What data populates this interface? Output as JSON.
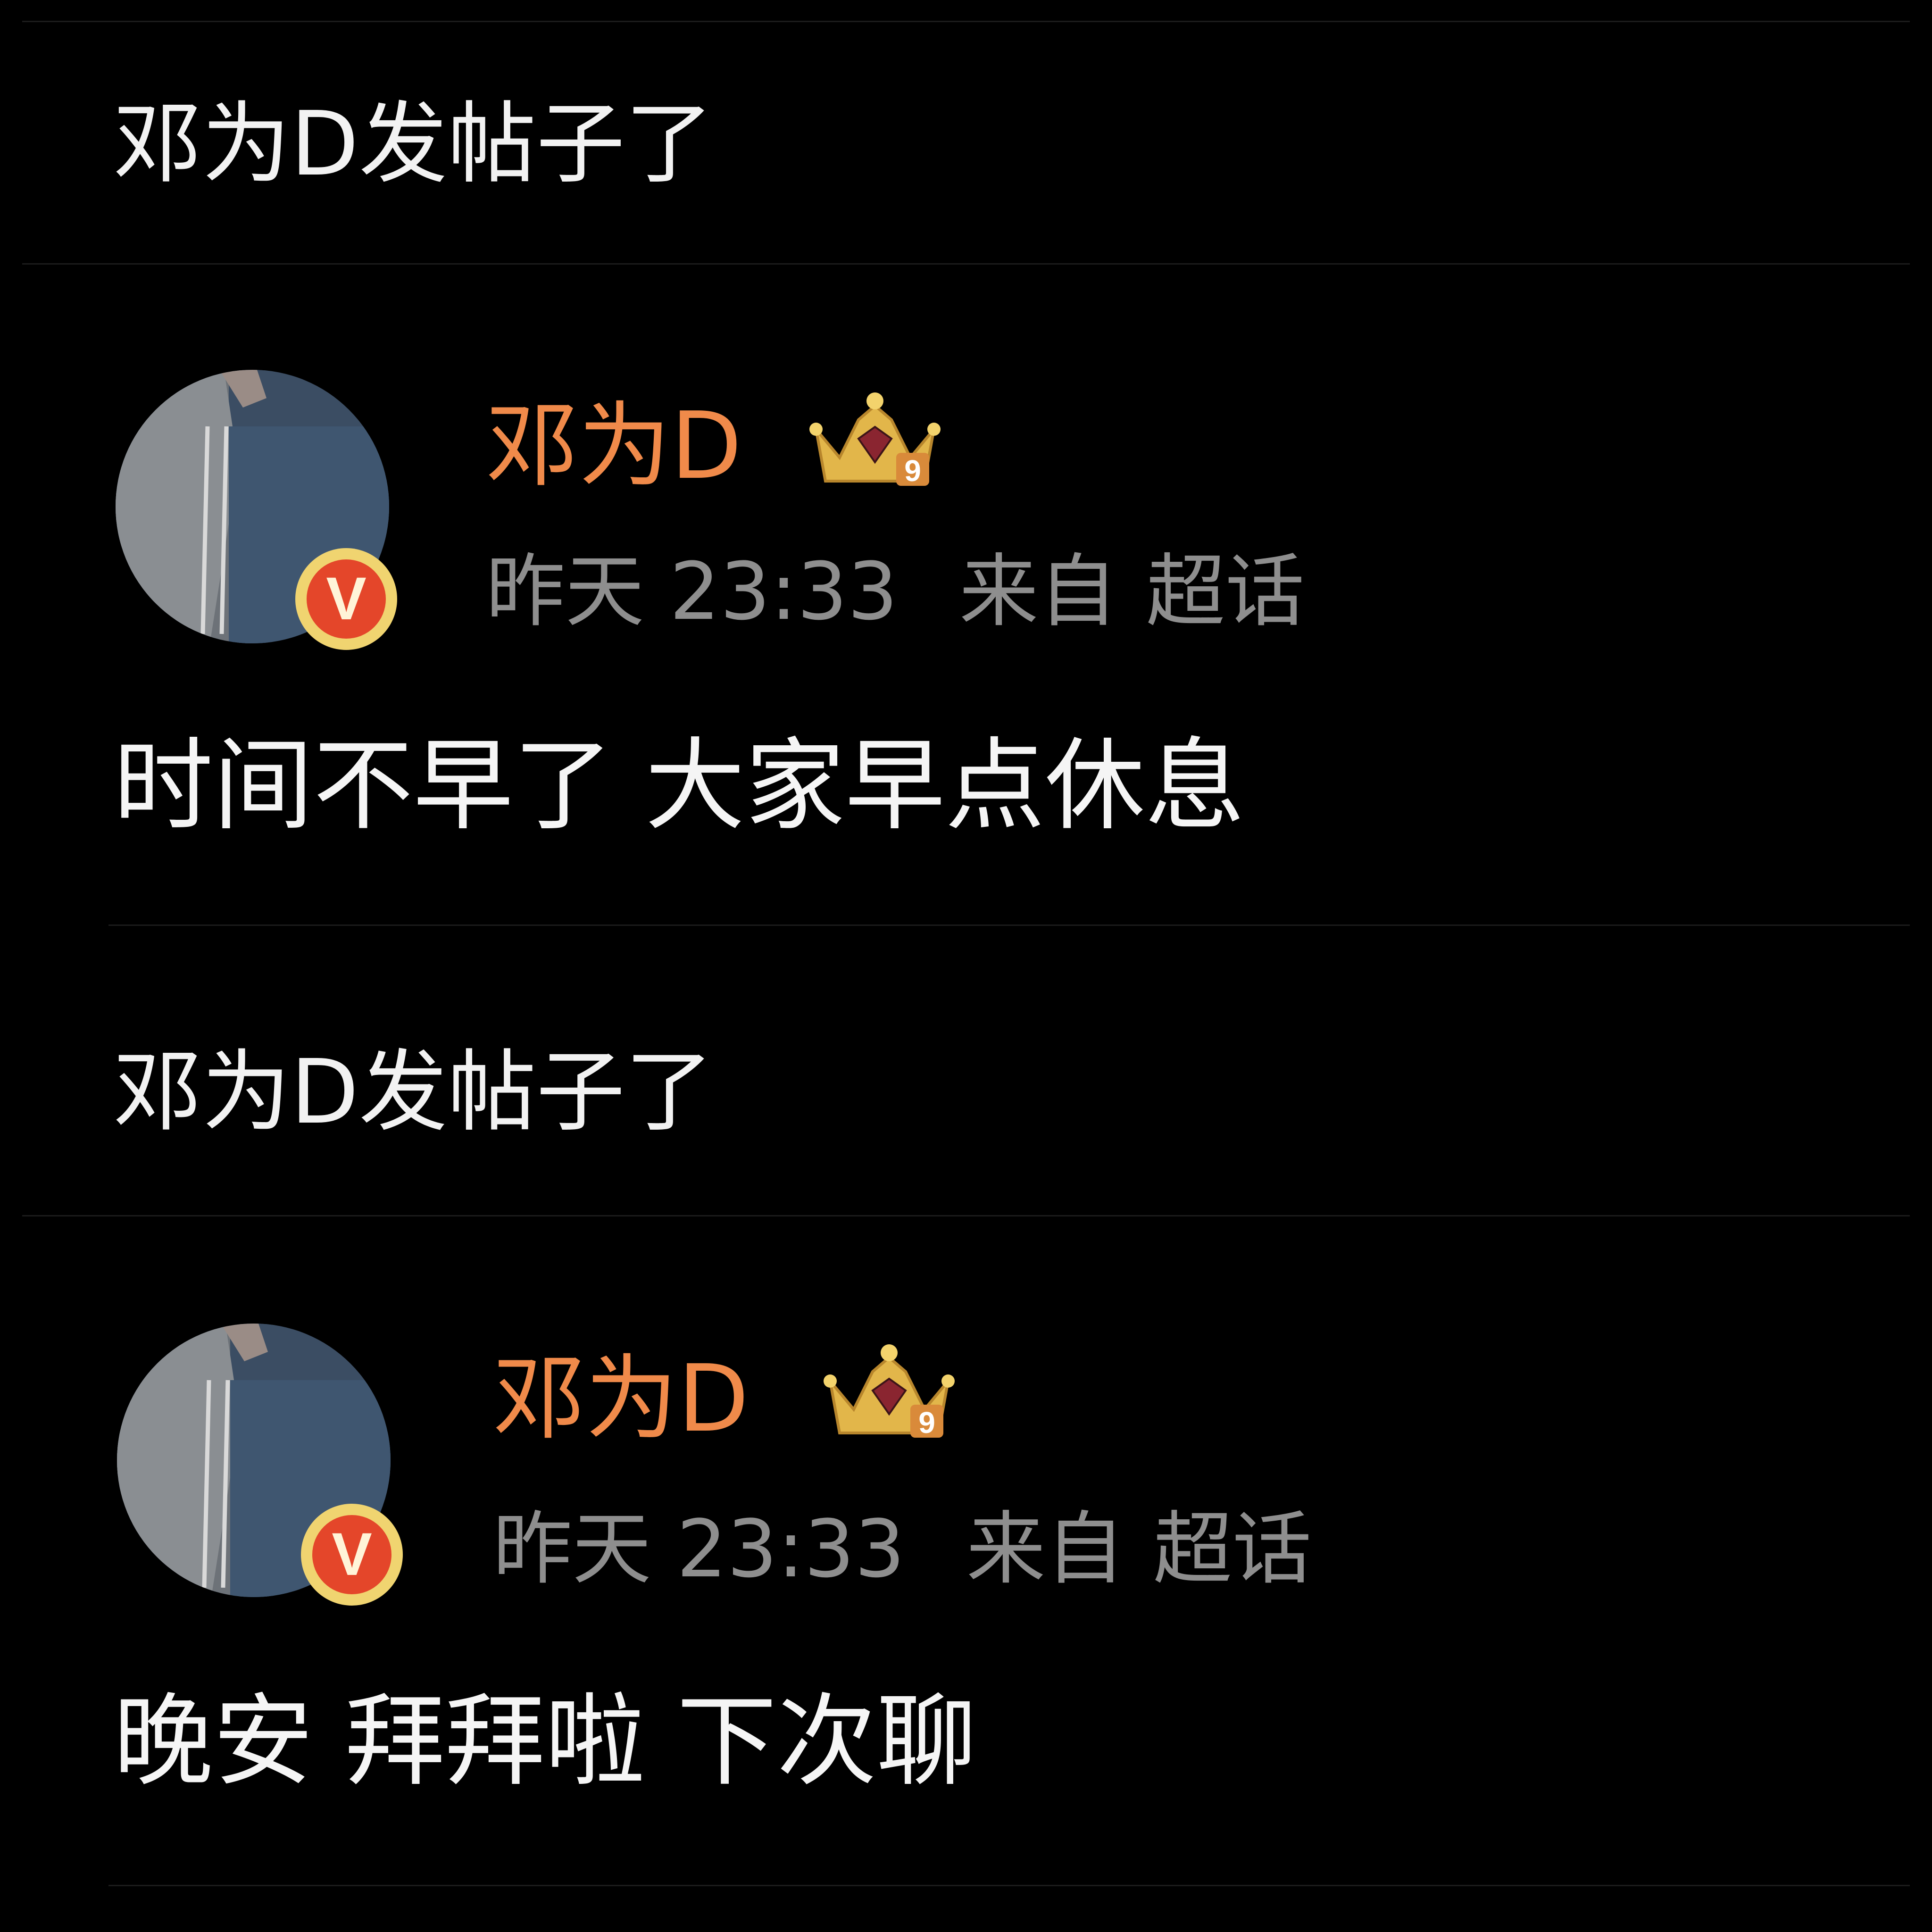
{
  "colors": {
    "background": "#000000",
    "username": "#f08a4a",
    "meta": "#8e8e8e",
    "text": "#f5f5f5",
    "divider": "#1b1b1b",
    "verified_badge": "#e4462a"
  },
  "posts": [
    {
      "notice": "邓为D发帖子了",
      "author": {
        "name": "邓为D",
        "avatar": "avatar-photo",
        "verified_badge": "V",
        "level_badge": "9"
      },
      "time": "昨天 23:33",
      "source_prefix": "来自",
      "source": "超话",
      "content": "时间不早了 大家早点休息"
    },
    {
      "notice": "邓为D发帖子了",
      "author": {
        "name": "邓为D",
        "avatar": "avatar-photo",
        "verified_badge": "V",
        "level_badge": "9"
      },
      "time": "昨天 23:33",
      "source_prefix": "来自",
      "source": "超话",
      "content": "晚安 拜拜啦 下次聊"
    }
  ]
}
